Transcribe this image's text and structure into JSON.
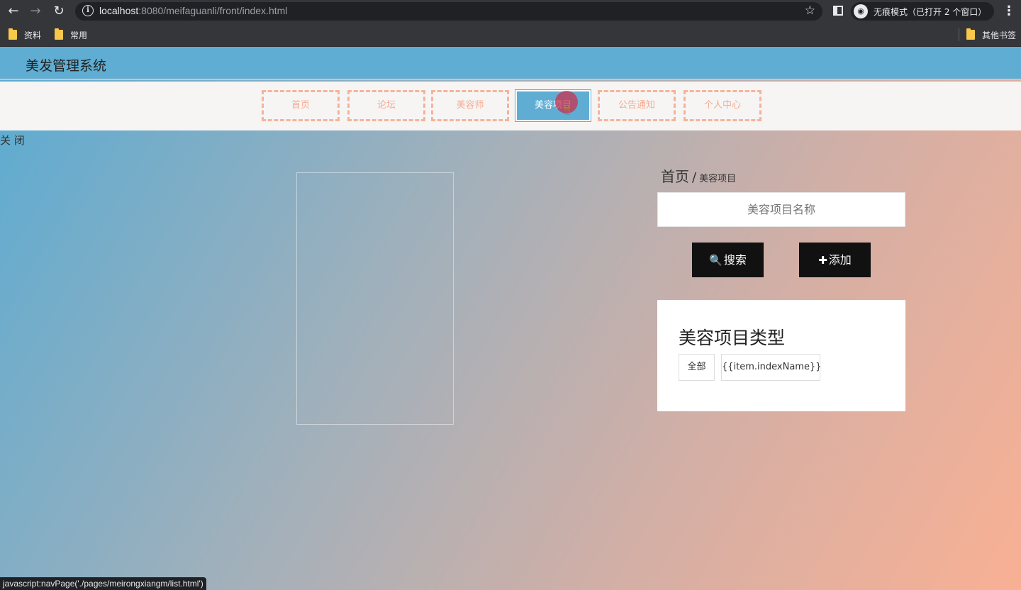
{
  "browser": {
    "url_host": "localhost",
    "url_rest": ":8080/meifaguanli/front/index.html",
    "incognito_text": "无痕模式（已打开 2 个窗口）",
    "bookmarks": [
      {
        "label": "资料"
      },
      {
        "label": "常用"
      }
    ],
    "other_bookmarks": "其他书签",
    "status_url": "javascript:navPage('./pages/meirongxiangm/list.html')"
  },
  "site": {
    "title": "美发管理系统",
    "nav": [
      {
        "label": "首页",
        "active": false
      },
      {
        "label": "论坛",
        "active": false
      },
      {
        "label": "美容师",
        "active": false
      },
      {
        "label": "美容项目",
        "active": true
      },
      {
        "label": "公告通知",
        "active": false
      },
      {
        "label": "个人中心",
        "active": false
      }
    ],
    "close_label": "关 闭"
  },
  "main": {
    "breadcrumb": {
      "home": "首页",
      "separator": "/",
      "current": "美容项目"
    },
    "search": {
      "placeholder": "美容项目名称",
      "value": ""
    },
    "buttons": {
      "search": "搜索",
      "add": "添加"
    },
    "type_card": {
      "title": "美容项目类型",
      "chips": [
        "全部",
        "{{item.indexName}}"
      ]
    }
  },
  "colors": {
    "header": "#5fadd3",
    "nav_accent": "#f5b39a",
    "button": "#111111"
  }
}
